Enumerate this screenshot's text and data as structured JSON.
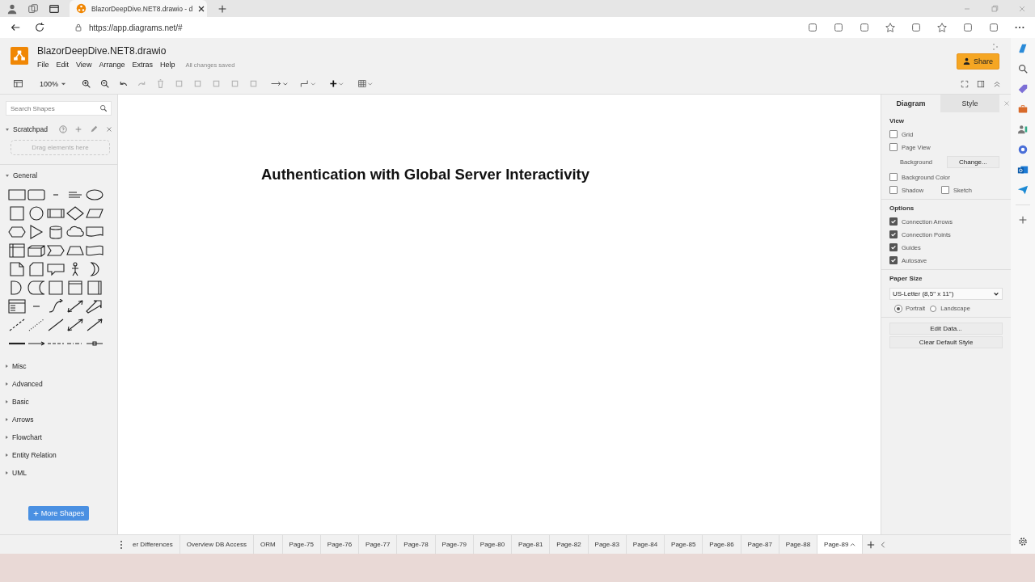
{
  "browser": {
    "tab_title": "BlazorDeepDive.NET8.drawio - d",
    "url": "https://app.diagrams.net/#"
  },
  "app": {
    "title": "BlazorDeepDive.NET8.drawio",
    "menu": [
      "File",
      "Edit",
      "View",
      "Arrange",
      "Extras",
      "Help"
    ],
    "save_status": "All changes saved",
    "share_label": "Share",
    "zoom": "100%"
  },
  "sidebar": {
    "search_placeholder": "Search Shapes",
    "scratchpad": {
      "title": "Scratchpad",
      "expanded": true,
      "drop_hint": "Drag elements here"
    },
    "sections": [
      {
        "title": "General",
        "expanded": true
      },
      {
        "title": "Misc",
        "expanded": false
      },
      {
        "title": "Advanced",
        "expanded": false
      },
      {
        "title": "Basic",
        "expanded": false
      },
      {
        "title": "Arrows",
        "expanded": false
      },
      {
        "title": "Flowchart",
        "expanded": false
      },
      {
        "title": "Entity Relation",
        "expanded": false
      },
      {
        "title": "UML",
        "expanded": false
      }
    ],
    "more_shapes": "More Shapes"
  },
  "canvas": {
    "heading": "Authentication with Global Server Interactivity"
  },
  "format_panel": {
    "tabs": [
      {
        "label": "Diagram",
        "selected": true
      },
      {
        "label": "Style",
        "selected": false
      }
    ],
    "view": {
      "title": "View",
      "rows": [
        {
          "kind": "checkboxes",
          "items": [
            {
              "label": "Grid",
              "checked": false
            }
          ]
        },
        {
          "kind": "checkboxes",
          "items": [
            {
              "label": "Page View",
              "checked": false
            }
          ]
        },
        {
          "kind": "background",
          "label": "Background",
          "button": "Change..."
        },
        {
          "kind": "checkboxes",
          "items": [
            {
              "label": "Background Color",
              "checked": false
            }
          ]
        },
        {
          "kind": "checkboxes",
          "items": [
            {
              "label": "Shadow",
              "checked": false
            },
            {
              "label": "Sketch",
              "checked": false
            }
          ]
        }
      ]
    },
    "options": {
      "title": "Options",
      "items": [
        {
          "label": "Connection Arrows",
          "checked": true
        },
        {
          "label": "Connection Points",
          "checked": true
        },
        {
          "label": "Guides",
          "checked": true
        },
        {
          "label": "Autosave",
          "checked": true
        }
      ]
    },
    "paper": {
      "title": "Paper Size",
      "size": "US-Letter (8,5\" x 11\")",
      "orientations": [
        {
          "label": "Portrait",
          "selected": true
        },
        {
          "label": "Landscape",
          "selected": false
        }
      ]
    },
    "buttons": [
      "Edit Data...",
      "Clear Default Style"
    ]
  },
  "pages": [
    {
      "label": "er Differences",
      "selected": false
    },
    {
      "label": "Overview DB Access",
      "selected": false
    },
    {
      "label": "ORM",
      "selected": false
    },
    {
      "label": "Page-75",
      "selected": false
    },
    {
      "label": "Page-76",
      "selected": false
    },
    {
      "label": "Page-77",
      "selected": false
    },
    {
      "label": "Page-78",
      "selected": false
    },
    {
      "label": "Page-79",
      "selected": false
    },
    {
      "label": "Page-80",
      "selected": false
    },
    {
      "label": "Page-81",
      "selected": false
    },
    {
      "label": "Page-82",
      "selected": false
    },
    {
      "label": "Page-83",
      "selected": false
    },
    {
      "label": "Page-84",
      "selected": false
    },
    {
      "label": "Page-85",
      "selected": false
    },
    {
      "label": "Page-86",
      "selected": false
    },
    {
      "label": "Page-87",
      "selected": false
    },
    {
      "label": "Page-88",
      "selected": false
    },
    {
      "label": "Page-89",
      "selected": true
    }
  ]
}
